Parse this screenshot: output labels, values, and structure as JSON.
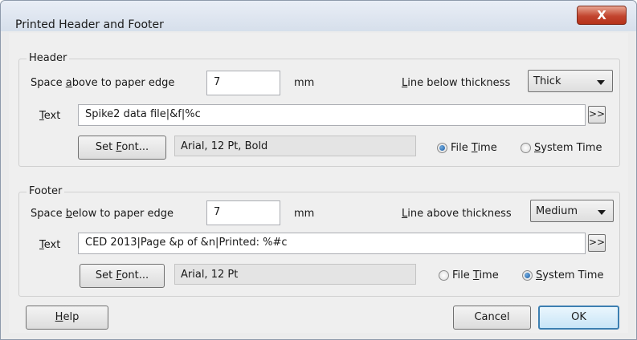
{
  "window": {
    "title": "Printed Header and Footer",
    "close_glyph": "X"
  },
  "header": {
    "group_label": "Header",
    "space_label_pre": "Space ",
    "space_label_key": "a",
    "space_label_post": "bove to paper edge",
    "space_value": "7",
    "unit": "mm",
    "line_label_key": "L",
    "line_label_post": "ine below thickness",
    "line_value": "Thick",
    "text_label_key": "T",
    "text_label_post": "ext",
    "text_value": "Spike2 data file|&f|%c",
    "more_label": ">>",
    "font_button_pre": "Set ",
    "font_button_key": "F",
    "font_button_post": "ont...",
    "font_value": "Arial, 12 Pt, Bold",
    "file_time_pre": "File ",
    "file_time_key": "T",
    "file_time_post": "ime",
    "system_time_key": "S",
    "system_time_post": "ystem Time",
    "selected": "file_time"
  },
  "footer": {
    "group_label": "Footer",
    "space_label_pre": "Space ",
    "space_label_key": "b",
    "space_label_post": "elow to paper edge",
    "space_value": "7",
    "unit": "mm",
    "line_label_key": "L",
    "line_label_post": "ine above thickness",
    "line_value": "Medium",
    "text_label_key": "T",
    "text_label_post": "ext",
    "text_value": "CED 2013|Page &p of &n|Printed: %#c",
    "more_label": ">>",
    "font_button_pre": "Set ",
    "font_button_key": "F",
    "font_button_post": "ont...",
    "font_value": "Arial, 12 Pt",
    "file_time_pre": "File ",
    "file_time_key": "T",
    "file_time_post": "ime",
    "system_time_key": "S",
    "system_time_post": "ystem Time",
    "selected": "system_time"
  },
  "buttons": {
    "help_key": "H",
    "help_post": "elp",
    "cancel": "Cancel",
    "ok": "OK"
  },
  "colors": {
    "ok_border": "#3c7fb1",
    "close_red": "#c2452f",
    "radio_selected": "#1d5fa6"
  }
}
